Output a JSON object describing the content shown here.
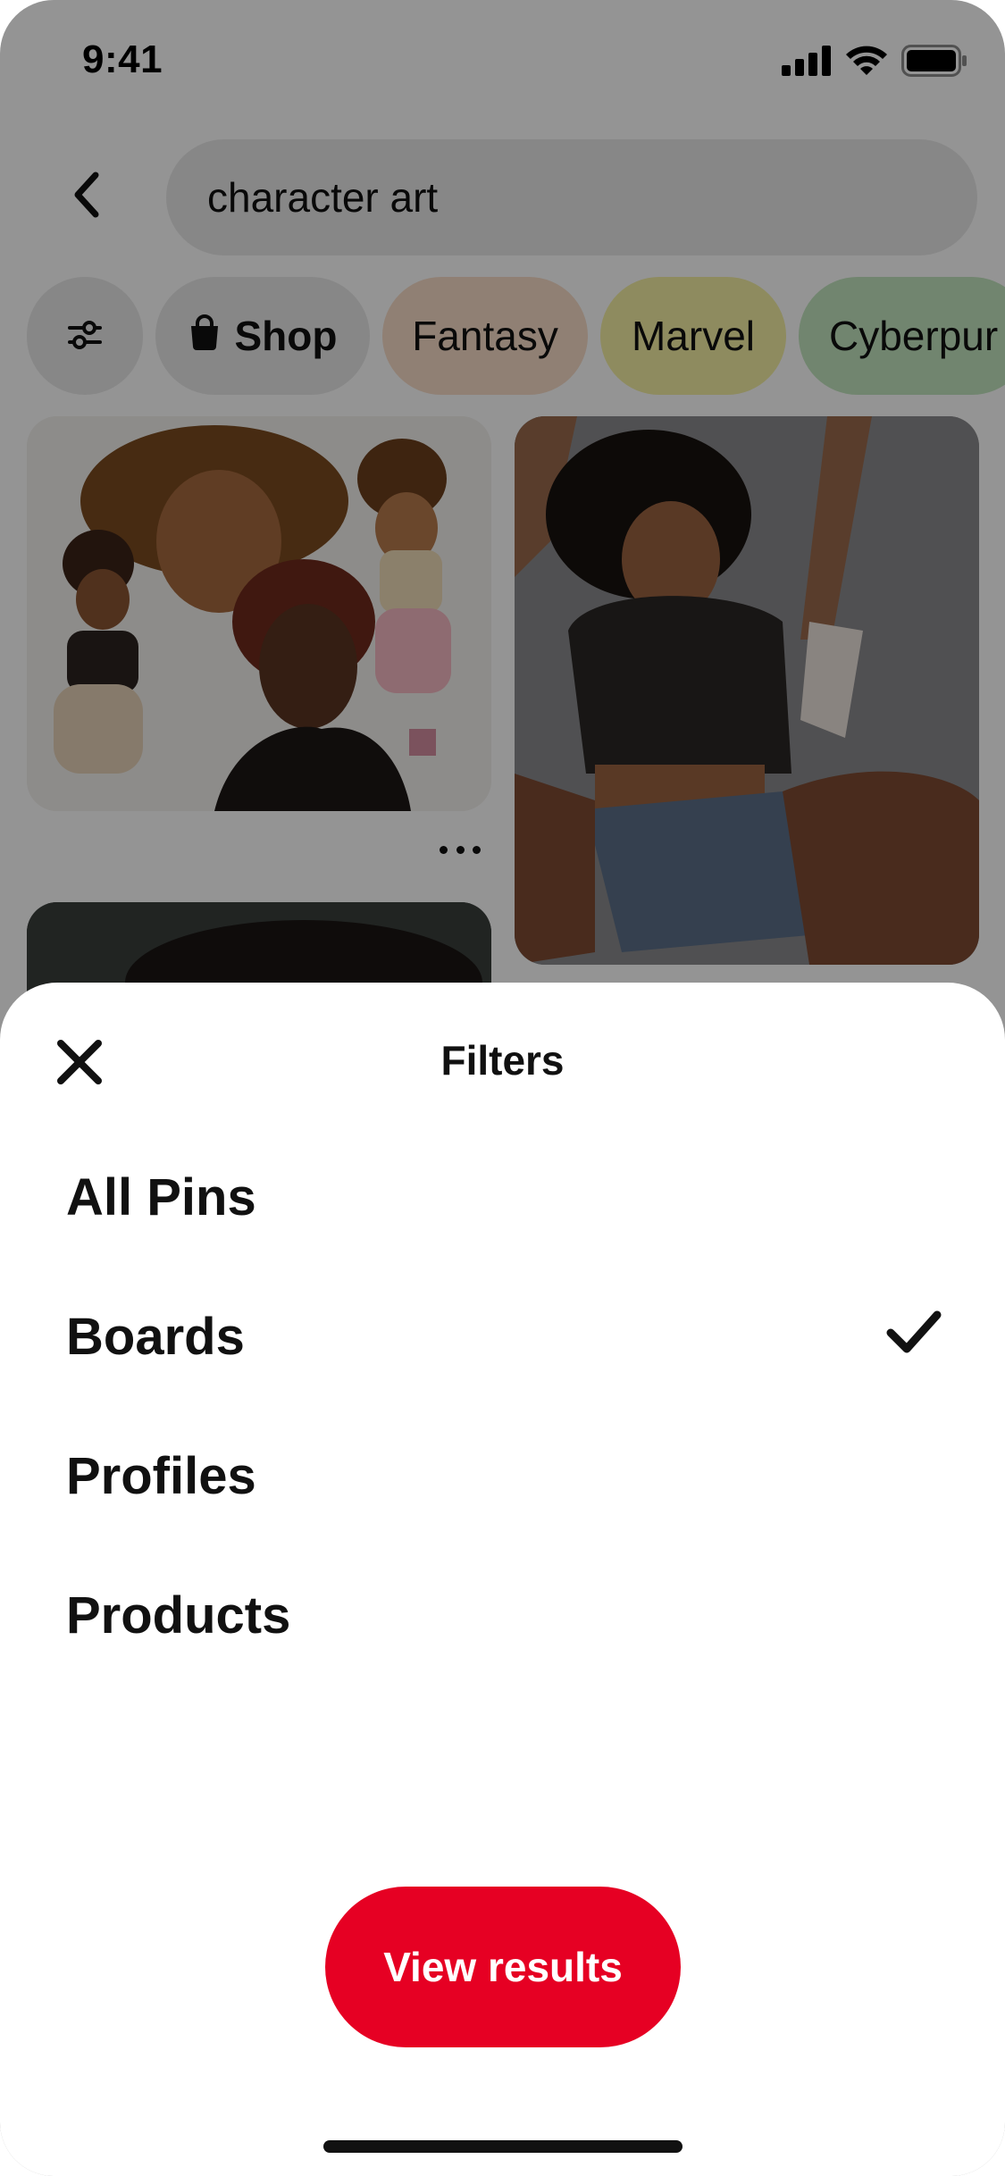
{
  "status_bar": {
    "time": "9:41",
    "icons": [
      "cellular-signal-icon",
      "wifi-icon",
      "battery-icon"
    ]
  },
  "search": {
    "back_icon": "chevron-left-icon",
    "query": "character art"
  },
  "chips": [
    {
      "label": "",
      "icon": "filter-sliders-icon",
      "color": "#e9e9e9"
    },
    {
      "label": "Shop",
      "icon": "shopping-bag-icon",
      "color": "#e9e9e9"
    },
    {
      "label": "Fantasy",
      "color": "#f8dcc8"
    },
    {
      "label": "Marvel",
      "color": "#f4f0a4"
    },
    {
      "label": "Cyberpur",
      "color": "#c3e6c0"
    }
  ],
  "pins": {
    "more_icon": "more-dots-icon"
  },
  "sheet": {
    "close_icon": "close-icon",
    "title": "Filters",
    "options": [
      {
        "label": "All Pins",
        "selected": false
      },
      {
        "label": "Boards",
        "selected": true
      },
      {
        "label": "Profiles",
        "selected": false
      },
      {
        "label": "Products",
        "selected": false
      }
    ],
    "check_icon": "checkmark-icon",
    "action_label": "View results"
  },
  "colors": {
    "accent": "#e60023",
    "overlay": "rgba(0,0,0,0.42)",
    "chip_bg": "#e9e9e9"
  }
}
